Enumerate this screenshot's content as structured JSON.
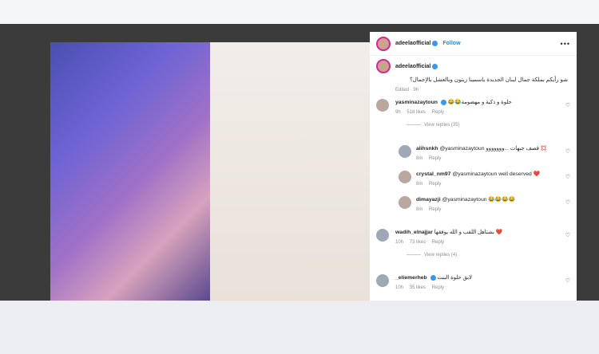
{
  "post": {
    "username": "adeelaofficial",
    "follow": "Follow",
    "more": "•••",
    "caption_user": "adeelaofficial",
    "caption": "شو رأيكم بملكة جمال لبنان الجديدة ياسمينا زيتون وبالعشل بالإجمال؟",
    "edited": "Edited · 9h"
  },
  "comments": [
    {
      "user": "yasminazaytoun",
      "text": "😂😂حلوة و ذكية و مهضومة",
      "time": "9h",
      "likes": "518 likes",
      "reply": "Reply",
      "view_replies": "View replies (35)"
    },
    {
      "user": "alihsnkh",
      "text": "@yasminazaytoun قصف جبهات ...ووووووو 💢",
      "time": "8m",
      "reply": "Reply"
    },
    {
      "user": "crystal_nm97",
      "text": "@yasminazaytoun well deserved ❤️",
      "time": "8m",
      "reply": "Reply"
    },
    {
      "user": "dimayazji",
      "text": "@yasminazaytoun 😂😂😂😂",
      "time": "8m",
      "reply": "Reply"
    },
    {
      "user": "wadih_elnajjar",
      "text": "بشتاهل اللقب و الله يوفقها ❤️",
      "time": "10h",
      "likes": "73 likes",
      "reply": "Reply",
      "view_replies": "View replies (4)"
    },
    {
      "user": "_eliemerheb",
      "text": "لابق حلوة البنت",
      "time": "10h",
      "likes": "35 likes",
      "reply": "Reply"
    }
  ]
}
